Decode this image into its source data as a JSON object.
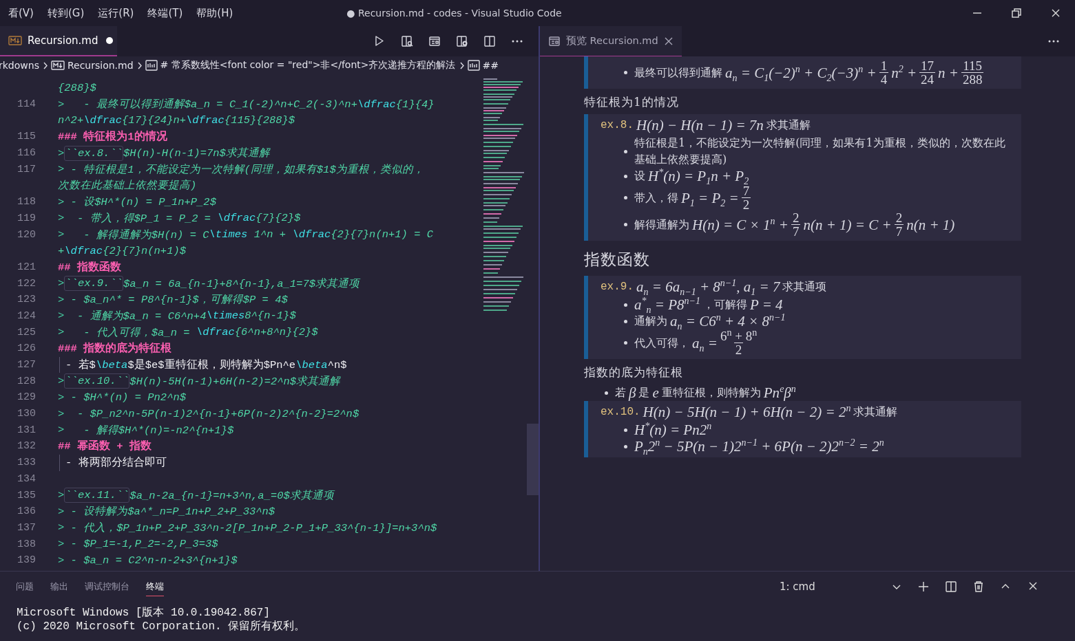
{
  "title_bar": {
    "menu": [
      "看(V)",
      "转到(G)",
      "运行(R)",
      "终端(T)",
      "帮助(H)"
    ],
    "title": "● Recursion.md - codes - Visual Studio Code"
  },
  "editor": {
    "tab": {
      "label": "Recursion.md",
      "dirty": true
    },
    "breadcrumb": [
      {
        "kind": "folder",
        "label": "rkdowns"
      },
      {
        "kind": "file",
        "label": "Recursion.md"
      },
      {
        "kind": "symbol",
        "label": "# 常系数线性<font color = \"red\">非</font>齐次递推方程的解法"
      },
      {
        "kind": "symbol",
        "label": "##"
      }
    ],
    "lines": [
      {
        "kind": "wrap",
        "segments": [
          {
            "kind": "text",
            "text": "{288}$"
          }
        ]
      },
      {
        "kind": "code",
        "number": "114",
        "segments": [
          {
            "kind": "quote",
            "text": ">"
          },
          {
            "kind": "text",
            "text": "   - 最终可以得到通解$a_n = C_1(-2)^n+C_2(-3)^n+"
          },
          {
            "kind": "kw",
            "text": "\\dfrac"
          },
          {
            "kind": "text",
            "text": "{1}{4}"
          }
        ]
      },
      {
        "kind": "wrap",
        "segments": [
          {
            "kind": "text",
            "text": "n^2+"
          },
          {
            "kind": "kw",
            "text": "\\dfrac"
          },
          {
            "kind": "text",
            "text": "{17}{24}n+"
          },
          {
            "kind": "kw",
            "text": "\\dfrac"
          },
          {
            "kind": "text",
            "text": "{115}{288}$"
          }
        ]
      },
      {
        "kind": "code",
        "number": "115",
        "segments": [
          {
            "kind": "heading",
            "text": "### 特征根为1的情况"
          }
        ]
      },
      {
        "kind": "code",
        "number": "116",
        "segments": [
          {
            "kind": "quote",
            "text": ">"
          },
          {
            "kind": "code",
            "text": "``ex.8.``"
          },
          {
            "kind": "text",
            "text": "$H(n)-H(n-1)=7n$求其通解"
          }
        ]
      },
      {
        "kind": "code",
        "number": "117",
        "segments": [
          {
            "kind": "quote",
            "text": ">"
          },
          {
            "kind": "text",
            "text": " - 特征根是1，不能设定为一次特解(同理，如果有$1$为重根，类似的，"
          }
        ]
      },
      {
        "kind": "wrap",
        "segments": [
          {
            "kind": "text",
            "text": "次数在此基础上依然要提高)"
          }
        ]
      },
      {
        "kind": "code",
        "number": "118",
        "segments": [
          {
            "kind": "quote",
            "text": ">"
          },
          {
            "kind": "text",
            "text": " - 设$H^*(n) = P_1n+P_2$"
          }
        ]
      },
      {
        "kind": "code",
        "number": "119",
        "segments": [
          {
            "kind": "quote",
            "text": ">"
          },
          {
            "kind": "text",
            "text": "  - 带入，得$P_1 = P_2 = "
          },
          {
            "kind": "kw",
            "text": "\\dfrac"
          },
          {
            "kind": "text",
            "text": "{7}{2}$"
          }
        ]
      },
      {
        "kind": "code",
        "number": "120",
        "segments": [
          {
            "kind": "quote",
            "text": ">"
          },
          {
            "kind": "text",
            "text": "   - 解得通解为$H(n) = C"
          },
          {
            "kind": "kw",
            "text": "\\times"
          },
          {
            "kind": "text",
            "text": " 1^n + "
          },
          {
            "kind": "kw",
            "text": "\\dfrac"
          },
          {
            "kind": "text",
            "text": "{2}{7}n(n+1) = C"
          }
        ]
      },
      {
        "kind": "wrap",
        "segments": [
          {
            "kind": "text",
            "text": "+"
          },
          {
            "kind": "kw",
            "text": "\\dfrac"
          },
          {
            "kind": "text",
            "text": "{2}{7}n(n+1)$"
          }
        ]
      },
      {
        "kind": "code",
        "number": "121",
        "segments": [
          {
            "kind": "heading",
            "text": "## 指数函数"
          }
        ]
      },
      {
        "kind": "code",
        "number": "122",
        "segments": [
          {
            "kind": "quote",
            "text": ">"
          },
          {
            "kind": "code",
            "text": "``ex.9.``"
          },
          {
            "kind": "text",
            "text": "$a_n = 6a_{n-1}+8^{n-1},a_1=7$求其通项"
          }
        ]
      },
      {
        "kind": "code",
        "number": "123",
        "segments": [
          {
            "kind": "quote",
            "text": ">"
          },
          {
            "kind": "text",
            "text": " - $a_n^* = P8^{n-1}$，可解得$P = 4$"
          }
        ]
      },
      {
        "kind": "code",
        "number": "124",
        "segments": [
          {
            "kind": "quote",
            "text": ">"
          },
          {
            "kind": "text",
            "text": "  - 通解为$a_n = C6^n+4"
          },
          {
            "kind": "kw",
            "text": "\\times"
          },
          {
            "kind": "text",
            "text": "8^{n-1}$"
          }
        ]
      },
      {
        "kind": "code",
        "number": "125",
        "segments": [
          {
            "kind": "quote",
            "text": ">"
          },
          {
            "kind": "text",
            "text": "   - 代入可得，$a_n = "
          },
          {
            "kind": "kw",
            "text": "\\dfrac"
          },
          {
            "kind": "text",
            "text": "{6^n+8^n}{2}$"
          }
        ]
      },
      {
        "kind": "code",
        "number": "126",
        "segments": [
          {
            "kind": "heading",
            "text": "### 指数的底为特征根"
          }
        ]
      },
      {
        "kind": "list",
        "number": "127",
        "segments": [
          {
            "kind": "plain",
            "text": "- 若$"
          },
          {
            "kind": "kw",
            "text": "\\beta"
          },
          {
            "kind": "plain",
            "text": "$是$e$重特征根，则特解为$Pn^e"
          },
          {
            "kind": "kw",
            "text": "\\beta"
          },
          {
            "kind": "plain",
            "text": "^n$"
          }
        ]
      },
      {
        "kind": "code",
        "number": "128",
        "segments": [
          {
            "kind": "quote",
            "text": ">"
          },
          {
            "kind": "code",
            "text": "``ex.10.``"
          },
          {
            "kind": "text",
            "text": "$H(n)-5H(n-1)+6H(n-2)=2^n$求其通解"
          }
        ]
      },
      {
        "kind": "code",
        "number": "129",
        "segments": [
          {
            "kind": "quote",
            "text": ">"
          },
          {
            "kind": "text",
            "text": " - $H^*(n) = Pn2^n$"
          }
        ]
      },
      {
        "kind": "code",
        "number": "130",
        "segments": [
          {
            "kind": "quote",
            "text": ">"
          },
          {
            "kind": "text",
            "text": "  - $P_n2^n-5P(n-1)2^{n-1}+6P(n-2)2^{n-2}=2^n$"
          }
        ]
      },
      {
        "kind": "code",
        "number": "131",
        "segments": [
          {
            "kind": "quote",
            "text": ">"
          },
          {
            "kind": "text",
            "text": "   - 解得$H^*(n)=-n2^{n+1}$"
          }
        ]
      },
      {
        "kind": "code",
        "number": "132",
        "segments": [
          {
            "kind": "heading",
            "text": "## 幂函数 + 指数"
          }
        ]
      },
      {
        "kind": "list",
        "number": "133",
        "segments": [
          {
            "kind": "plain",
            "text": "- 将两部分结合即可"
          }
        ]
      },
      {
        "kind": "blank",
        "number": "134"
      },
      {
        "kind": "code",
        "number": "135",
        "segments": [
          {
            "kind": "quote",
            "text": ">"
          },
          {
            "kind": "code",
            "text": "``ex.11.``"
          },
          {
            "kind": "text",
            "text": "$a_n-2a_{n-1}=n+3^n,a_=0$求其通项"
          }
        ]
      },
      {
        "kind": "code",
        "number": "136",
        "segments": [
          {
            "kind": "quote",
            "text": ">"
          },
          {
            "kind": "text",
            "text": " - 设特解为$a^*_n=P_1n+P_2+P_33^n$"
          }
        ]
      },
      {
        "kind": "code",
        "number": "137",
        "segments": [
          {
            "kind": "quote",
            "text": ">"
          },
          {
            "kind": "text",
            "text": " - 代入，$P_1n+P_2+P_33^n-2[P_1n+P_2-P_1+P_33^{n-1}]=n+3^n$"
          }
        ]
      },
      {
        "kind": "code",
        "number": "138",
        "segments": [
          {
            "kind": "quote",
            "text": ">"
          },
          {
            "kind": "text",
            "text": " - $P_1=-1,P_2=-2,P_3=3$"
          }
        ]
      },
      {
        "kind": "code",
        "number": "139",
        "segments": [
          {
            "kind": "quote",
            "text": ">"
          },
          {
            "kind": "text",
            "text": " - $a_n = C2^n-n-2+3^{n+1}$"
          }
        ]
      }
    ]
  },
  "preview": {
    "tab": {
      "label": "预览 Recursion.md"
    },
    "blocks": [
      {
        "kind": "quote",
        "items": [
          [
            {
              "kind": "text",
              "text": "最终可以得到通解"
            },
            {
              "kind": "math",
              "text": "a$_{n}$ = C$_{1}$(−2)$^{n}$ + C$_{2}$(−3)$^{n}$ +"
            },
            {
              "kind": "frac",
              "num": "1",
              "den": "4"
            },
            {
              "kind": "math",
              "text": "n$^{2}$ +"
            },
            {
              "kind": "frac",
              "num": "17",
              "den": "24"
            },
            {
              "kind": "math",
              "text": "n +"
            },
            {
              "kind": "frac",
              "num": "115",
              "den": "288"
            }
          ]
        ]
      },
      {
        "kind": "h3",
        "text": "特征根为1的情况"
      },
      {
        "kind": "quote",
        "code": "ex.8.",
        "title": [
          {
            "kind": "math",
            "text": "H(n) − H(n − 1) = 7n"
          },
          {
            "kind": "text",
            "text": "求其通解"
          }
        ],
        "items": [
          [
            {
              "kind": "text",
              "text": "特征根是1，不能设定为一次特解(同理，如果有1为重根，类似的，次数在此基础上依然要提高)"
            }
          ],
          [
            {
              "kind": "text",
              "text": "设"
            },
            {
              "kind": "math",
              "text": "H$^{*}$(n) = P$_{1}$n + P$_{2}$"
            }
          ],
          [
            {
              "kind": "text",
              "text": "带入，得"
            },
            {
              "kind": "math",
              "text": "P$_{1}$ = P$_{2}$ ="
            },
            {
              "kind": "frac",
              "num": "7",
              "den": "2"
            }
          ],
          [
            {
              "kind": "text",
              "text": "解得通解为"
            },
            {
              "kind": "math",
              "text": "H(n) = C × 1$^{n}$ +"
            },
            {
              "kind": "frac",
              "num": "2",
              "den": "7"
            },
            {
              "kind": "math",
              "text": "n(n + 1) = C +"
            },
            {
              "kind": "frac",
              "num": "2",
              "den": "7"
            },
            {
              "kind": "math",
              "text": "n(n + 1)"
            }
          ]
        ]
      },
      {
        "kind": "h2",
        "text": "指数函数"
      },
      {
        "kind": "quote",
        "code": "ex.9.",
        "title": [
          {
            "kind": "math",
            "text": "a$_{n}$ = 6a$_{n−1}$ + 8$^{n−1}$, a$_{1}$ = 7"
          },
          {
            "kind": "text",
            "text": "求其通项"
          }
        ],
        "items": [
          [
            {
              "kind": "math",
              "text": "a$^{*}$$_{n}$ = P8$^{n−1}$"
            },
            {
              "kind": "text",
              "text": "，可解得"
            },
            {
              "kind": "math",
              "text": "P = 4"
            }
          ],
          [
            {
              "kind": "text",
              "text": "通解为"
            },
            {
              "kind": "math",
              "text": "a$_{n}$ = C6$^{n}$ + 4 × 8$^{n−1}$"
            }
          ],
          [
            {
              "kind": "text",
              "text": "代入可得，"
            },
            {
              "kind": "math",
              "text": "a$_{n}$ ="
            },
            {
              "kind": "frac",
              "num": "6$^{n}$ + 8$^{n}$",
              "den": "2"
            }
          ]
        ]
      },
      {
        "kind": "h3",
        "text": "指数的底为特征根"
      },
      {
        "kind": "list",
        "items": [
          [
            {
              "kind": "text",
              "text": "若"
            },
            {
              "kind": "math",
              "text": "β"
            },
            {
              "kind": "text",
              "text": "是"
            },
            {
              "kind": "math",
              "text": "e"
            },
            {
              "kind": "text",
              "text": "重特征根，则特解为"
            },
            {
              "kind": "math",
              "text": "Pn$^{e}$β$^{n}$"
            }
          ]
        ]
      },
      {
        "kind": "quote",
        "code": "ex.10.",
        "title": [
          {
            "kind": "math",
            "text": "H(n) − 5H(n − 1) + 6H(n − 2) = 2$^{n}$"
          },
          {
            "kind": "text",
            "text": "求其通解"
          }
        ],
        "items": [
          [
            {
              "kind": "math",
              "text": "H$^{*}$(n) = Pn2$^{n}$"
            }
          ],
          [
            {
              "kind": "math",
              "text": "P$_{n}$2$^{n}$ − 5P(n − 1)2$^{n−1}$ + 6P(n − 2)2$^{n−2}$ = 2$^{n}$"
            }
          ]
        ]
      }
    ]
  },
  "panel": {
    "tabs": [
      {
        "label": "问题",
        "selected": false
      },
      {
        "label": "输出",
        "selected": false
      },
      {
        "label": "调试控制台",
        "selected": false
      },
      {
        "label": "终端",
        "selected": true
      }
    ],
    "terminal_select": "1: cmd",
    "terminal_lines": [
      "Microsoft Windows [版本 10.0.19042.867]",
      "(c) 2020 Microsoft Corporation. 保留所有权利。"
    ]
  }
}
